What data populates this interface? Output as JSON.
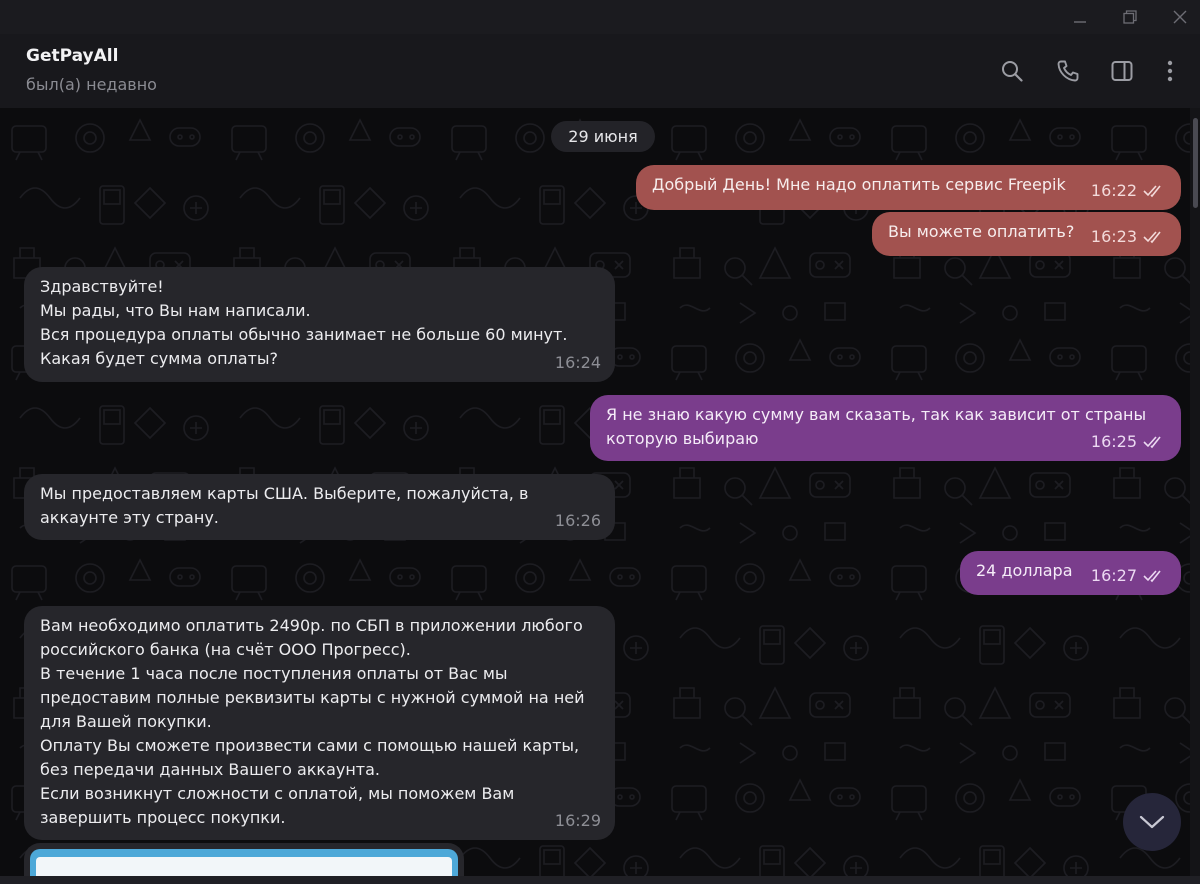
{
  "chat": {
    "title": "GetPayAll",
    "status": "был(а) недавно"
  },
  "icons": {
    "window": [
      "minimize-icon",
      "restore-icon",
      "close-icon"
    ],
    "header": [
      "search-icon",
      "phone-icon",
      "sidebar-icon",
      "more-icon"
    ],
    "scroll": "chevron-down-icon",
    "read_status": "double-check-icon"
  },
  "colors": {
    "outgoing_red": "#a2524f",
    "outgoing_purple": "#7a3d8c",
    "incoming": "#26262b",
    "background": "#0c0c0e"
  },
  "date_separator": "29 июня",
  "messages": [
    {
      "direction": "out",
      "text": "Добрый День! Мне надо оплатить сервис Freepik",
      "time": "16:22",
      "read": true
    },
    {
      "direction": "out",
      "text": "Вы можете оплатить?",
      "time": "16:23",
      "read": true
    },
    {
      "direction": "in",
      "text": "Здравствуйте!\nМы рады, что Вы нам написали.\nВся процедура оплаты обычно занимает не больше 60 минут.\nКакая будет сумма оплаты?",
      "time": "16:24"
    },
    {
      "direction": "out",
      "text": "Я не знаю какую сумму вам сказать, так как зависит от страны\nкоторую выбираю",
      "time": "16:25",
      "read": true
    },
    {
      "direction": "in",
      "text": "Мы предоставляем карты США. Выберите, пожалуйста, в\nаккаунте эту страну.",
      "time": "16:26"
    },
    {
      "direction": "out",
      "text": "24 доллара",
      "time": "16:27",
      "read": true
    },
    {
      "direction": "in",
      "text": "Вам необходимо оплатить 2490р. по СБП в приложении любого\nроссийского банка (на счёт ООО Прогресс).\nВ течение 1 часа после поступления оплаты от Вас мы\nпредоставим полные реквизиты карты с нужной суммой на ней\nдля Вашей покупки.\nОплату Вы сможете произвести сами с помощью нашей карты,\nбез передачи данных Вашего аккаунта.\nЕсли возникнут сложности с оплатой, мы поможем Вам\nзавершить процесс покупки.",
      "time": "16:29"
    }
  ]
}
